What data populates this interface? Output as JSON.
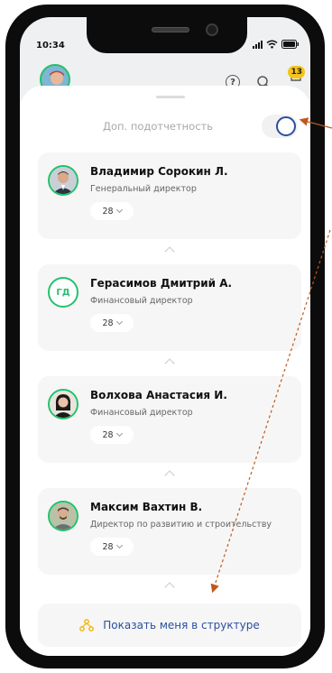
{
  "status": {
    "time": "10:34"
  },
  "header": {
    "badge_count": "13",
    "help_glyph": "?"
  },
  "toggle": {
    "label": "Доп. подотчетность",
    "on": true
  },
  "people": [
    {
      "name": "Владимир Сорокин Л.",
      "role": "Генеральный директор",
      "count": "28",
      "initials": ""
    },
    {
      "name": "Герасимов Дмитрий А.",
      "role": "Финансовый директор",
      "count": "28",
      "initials": "ГД"
    },
    {
      "name": "Волхова Анастасия И.",
      "role": "Финансовый директор",
      "count": "28",
      "initials": ""
    },
    {
      "name": "Максим Вахтин В.",
      "role": "Директор по развитию и строительству",
      "count": "28",
      "initials": ""
    }
  ],
  "show_me": {
    "label": "Показать меня в структуре"
  },
  "colors": {
    "accent": "#2a4fa0",
    "avatar_ring": "#24c26c",
    "badge": "#f5c41b",
    "annotation": "#c0581a"
  }
}
